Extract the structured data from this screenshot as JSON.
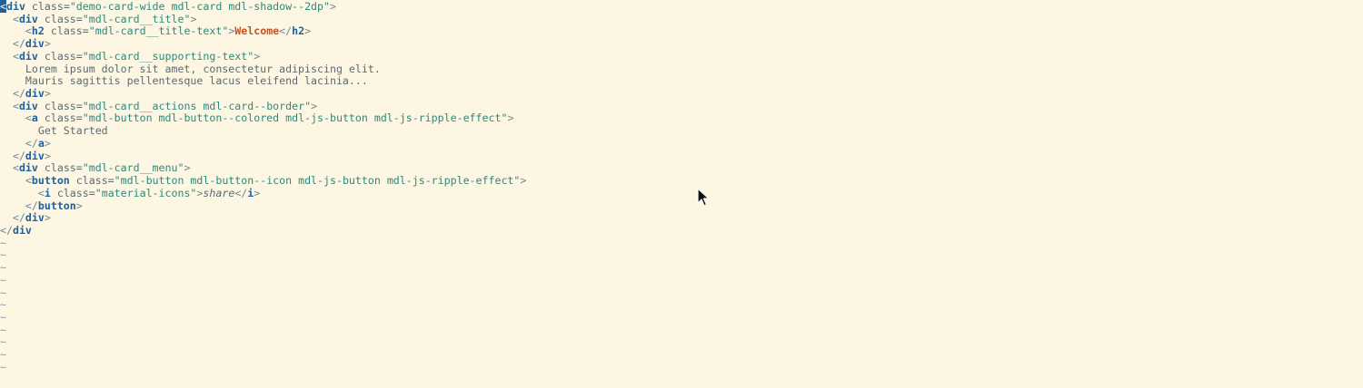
{
  "editor": {
    "lines": [
      [
        {
          "t": "<",
          "c": "cursor-block"
        },
        {
          "t": "div",
          "c": "tag"
        },
        {
          "t": " class=",
          "c": "attr"
        },
        {
          "t": "\"demo-card-wide mdl-card mdl-shadow--2dp\"",
          "c": "str"
        },
        {
          "t": ">",
          "c": "punct"
        }
      ],
      [
        {
          "t": "  <",
          "c": "punct"
        },
        {
          "t": "div",
          "c": "tag"
        },
        {
          "t": " class=",
          "c": "attr"
        },
        {
          "t": "\"mdl-card__title\"",
          "c": "str"
        },
        {
          "t": ">",
          "c": "punct"
        }
      ],
      [
        {
          "t": "    <",
          "c": "punct"
        },
        {
          "t": "h2",
          "c": "tag"
        },
        {
          "t": " class=",
          "c": "attr"
        },
        {
          "t": "\"mdl-card__title-text\"",
          "c": "str"
        },
        {
          "t": ">",
          "c": "punct"
        },
        {
          "t": "Welcome",
          "c": "text-red"
        },
        {
          "t": "</",
          "c": "punct"
        },
        {
          "t": "h2",
          "c": "tag"
        },
        {
          "t": ">",
          "c": "punct"
        }
      ],
      [
        {
          "t": "  </",
          "c": "punct"
        },
        {
          "t": "div",
          "c": "tag"
        },
        {
          "t": ">",
          "c": "punct"
        }
      ],
      [
        {
          "t": "  <",
          "c": "punct"
        },
        {
          "t": "div",
          "c": "tag"
        },
        {
          "t": " class=",
          "c": "attr"
        },
        {
          "t": "\"mdl-card__supporting-text\"",
          "c": "str"
        },
        {
          "t": ">",
          "c": "punct"
        }
      ],
      [
        {
          "t": "    Lorem ipsum dolor sit amet, consectetur adipiscing elit.",
          "c": "text"
        }
      ],
      [
        {
          "t": "    Mauris sagittis pellentesque lacus eleifend lacinia...",
          "c": "text"
        }
      ],
      [
        {
          "t": "  </",
          "c": "punct"
        },
        {
          "t": "div",
          "c": "tag"
        },
        {
          "t": ">",
          "c": "punct"
        }
      ],
      [
        {
          "t": "  <",
          "c": "punct"
        },
        {
          "t": "div",
          "c": "tag"
        },
        {
          "t": " class=",
          "c": "attr"
        },
        {
          "t": "\"mdl-card__actions mdl-card--border\"",
          "c": "str"
        },
        {
          "t": ">",
          "c": "punct"
        }
      ],
      [
        {
          "t": "    <",
          "c": "punct"
        },
        {
          "t": "a",
          "c": "tag"
        },
        {
          "t": " class=",
          "c": "attr"
        },
        {
          "t": "\"mdl-button mdl-button--colored mdl-js-button mdl-js-ripple-effect\"",
          "c": "str"
        },
        {
          "t": ">",
          "c": "punct"
        }
      ],
      [
        {
          "t": "      Get Started",
          "c": "text"
        }
      ],
      [
        {
          "t": "    </",
          "c": "punct"
        },
        {
          "t": "a",
          "c": "tag"
        },
        {
          "t": ">",
          "c": "punct"
        }
      ],
      [
        {
          "t": "  </",
          "c": "punct"
        },
        {
          "t": "div",
          "c": "tag"
        },
        {
          "t": ">",
          "c": "punct"
        }
      ],
      [
        {
          "t": "  <",
          "c": "punct"
        },
        {
          "t": "div",
          "c": "tag"
        },
        {
          "t": " class=",
          "c": "attr"
        },
        {
          "t": "\"mdl-card__menu\"",
          "c": "str"
        },
        {
          "t": ">",
          "c": "punct"
        }
      ],
      [
        {
          "t": "    <",
          "c": "punct"
        },
        {
          "t": "button",
          "c": "tag"
        },
        {
          "t": " class=",
          "c": "attr"
        },
        {
          "t": "\"mdl-button mdl-button--icon mdl-js-button mdl-js-ripple-effect\"",
          "c": "str"
        },
        {
          "t": ">",
          "c": "punct"
        }
      ],
      [
        {
          "t": "      <",
          "c": "punct"
        },
        {
          "t": "i",
          "c": "tag"
        },
        {
          "t": " class=",
          "c": "attr"
        },
        {
          "t": "\"material-icons\"",
          "c": "str"
        },
        {
          "t": ">",
          "c": "punct"
        },
        {
          "t": "share",
          "c": "text-italic"
        },
        {
          "t": "</",
          "c": "punct"
        },
        {
          "t": "i",
          "c": "tag"
        },
        {
          "t": ">",
          "c": "punct"
        }
      ],
      [
        {
          "t": "    </",
          "c": "punct"
        },
        {
          "t": "button",
          "c": "tag"
        },
        {
          "t": ">",
          "c": "punct"
        }
      ],
      [
        {
          "t": "  </",
          "c": "punct"
        },
        {
          "t": "div",
          "c": "tag"
        },
        {
          "t": ">",
          "c": "punct"
        }
      ],
      [
        {
          "t": "</",
          "c": "punct"
        },
        {
          "t": "div",
          "c": "tag"
        }
      ]
    ],
    "empty_line_marker": "~",
    "empty_line_count": 11
  }
}
